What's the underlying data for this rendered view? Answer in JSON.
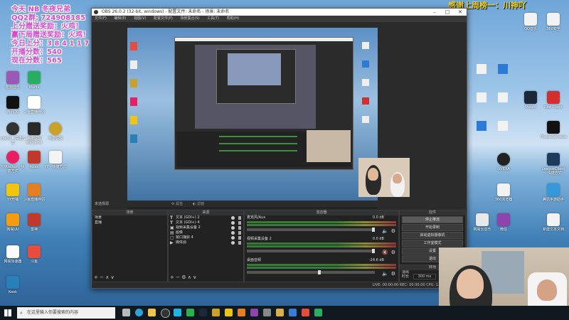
{
  "overlay": {
    "lines": [
      "今天 NB 冬夜兄弟",
      "QQ2群: 724908185",
      "上分赠送奖励：火鸡！",
      "赢下局赠送奖励：火鸡！",
      "今日上分：3 8 4 1 1 7",
      "开播分数：540",
      "现在分数：565"
    ],
    "thanks": "感谢上周榜一：川神吖"
  },
  "obs": {
    "title": "OBS 26.0.2 (32-bit, windows) - 配置文件: 未命名 - 场景: 未命名",
    "menu": [
      "文件(F)",
      "编辑(E)",
      "视图(V)",
      "配置文件(P)",
      "场景集合(S)",
      "工具(T)",
      "帮助(H)"
    ],
    "selected_source_label": "未选择源",
    "properties_label": "属性",
    "filters_label": "滤镜",
    "scenes": {
      "header": "场景",
      "items": [
        "场景",
        "直播"
      ]
    },
    "sources": {
      "header": "来源",
      "items": [
        "文本 (GDI+) 2",
        "文本 (GDI+) 4",
        "视频采集设备 2",
        "图像",
        "窗口捕获 4",
        "媒体源"
      ]
    },
    "mixer": {
      "header": "混音器",
      "channels": [
        {
          "name": "麦克风/Aux",
          "db": "0.0 dB",
          "level": 0.72,
          "slider": 0.98
        },
        {
          "name": "视频采集设备 2",
          "db": "0.0 dB",
          "level": 0.55,
          "slider": 0.98
        },
        {
          "name": "桌面音频",
          "db": "-24.6 dB",
          "level": 0.4,
          "slider": 0.55
        }
      ]
    },
    "transitions": {
      "header": "转场",
      "type": "淡出",
      "duration_label": "时长",
      "duration_value": "300 ms"
    },
    "controls": {
      "header": "控件",
      "buttons": [
        "停止推流",
        "开始录制",
        "启动虚拟摄像机",
        "工作室模式",
        "设置",
        "退出"
      ]
    },
    "statusbar": "LIVE: 00:00:00   REC: 00:00:00   CPU: 1.9%, 30.00 fps"
  },
  "desktop": {
    "left_icons": [
      "酷狗音乐",
      "MuMu",
      "腾讯QQ",
      "斗鱼直播伴侣",
      "obs32 - 快捷方式",
      "英雄联盟WeGame",
      "英雄联盟",
      "YYAnchor - 快捷方式",
      "Apex",
      "YY - 快捷方式",
      "YY开播",
      "斗鱼直播伴侣",
      "网易UU",
      "雷神",
      "网易加速器",
      "斗鱼",
      "Kook",
      "Photoshop"
    ],
    "right_icons": [
      "QQ音乐",
      "360安全",
      "Steam",
      "Riot Client",
      "Phasmophobia",
      "LeagueClient - 快捷方式",
      "腾讯手游助手",
      "网易云音乐",
      "新建文本文档",
      "NVIDIA",
      "360浏览器",
      "微信"
    ]
  },
  "taskbar": {
    "search_placeholder": "在这里输入你要搜索的内容",
    "apps": [
      "start",
      "search",
      "task-view",
      "edge",
      "explorer",
      "obs",
      "qq",
      "wechat",
      "steam",
      "league",
      "yy",
      "douyu",
      "kook",
      "settings",
      "folder",
      "store",
      "music"
    ]
  },
  "colors": {
    "overlay_text": "#d04bd0",
    "thanks_text": "#f0d020",
    "obs_bg": "#2b2b2b",
    "stop_stream_btn": "#5a5a5a"
  }
}
